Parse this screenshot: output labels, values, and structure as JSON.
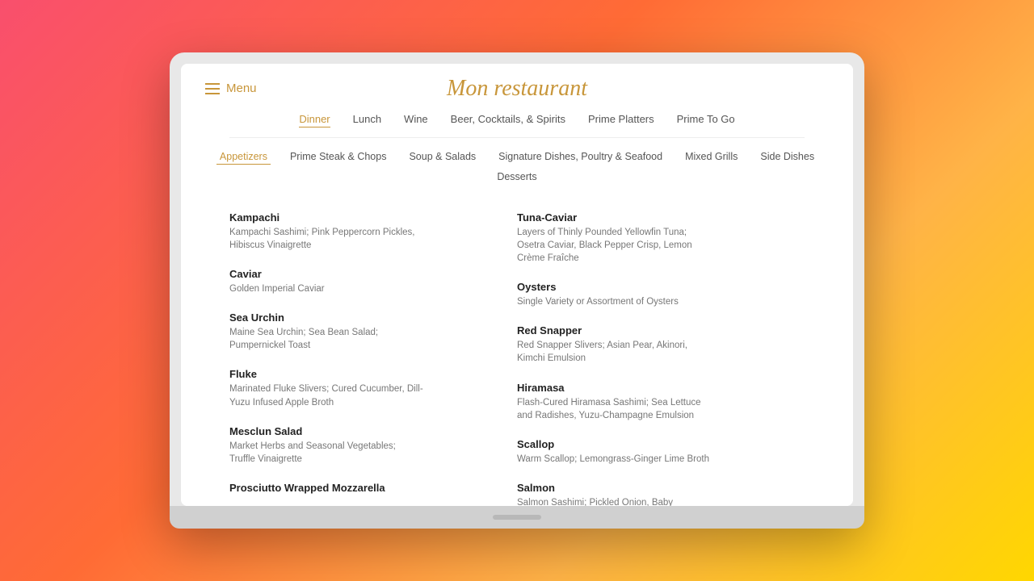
{
  "restaurant": {
    "title": "Mon restaurant"
  },
  "hamburger": {
    "label": "Menu"
  },
  "main_nav": {
    "items": [
      {
        "id": "dinner",
        "label": "Dinner",
        "active": true
      },
      {
        "id": "lunch",
        "label": "Lunch",
        "active": false
      },
      {
        "id": "wine",
        "label": "Wine",
        "active": false
      },
      {
        "id": "beer",
        "label": "Beer, Cocktails, & Spirits",
        "active": false
      },
      {
        "id": "platters",
        "label": "Prime Platters",
        "active": false
      },
      {
        "id": "togo",
        "label": "Prime To Go",
        "active": false
      }
    ]
  },
  "sub_nav": {
    "items": [
      {
        "id": "appetizers",
        "label": "Appetizers",
        "active": true
      },
      {
        "id": "prime-steak",
        "label": "Prime Steak & Chops",
        "active": false
      },
      {
        "id": "soup",
        "label": "Soup & Salads",
        "active": false
      },
      {
        "id": "signature",
        "label": "Signature Dishes, Poultry & Seafood",
        "active": false
      },
      {
        "id": "mixed-grills",
        "label": "Mixed Grills",
        "active": false
      },
      {
        "id": "side-dishes",
        "label": "Side Dishes",
        "active": false
      },
      {
        "id": "desserts",
        "label": "Desserts",
        "active": false
      }
    ]
  },
  "menu_items": {
    "left_column": [
      {
        "name": "Kampachi",
        "description": "Kampachi Sashimi; Pink Peppercorn Pickles, Hibiscus Vinaigrette"
      },
      {
        "name": "Caviar",
        "description": "Golden Imperial Caviar"
      },
      {
        "name": "Sea Urchin",
        "description": "Maine Sea Urchin; Sea Bean Salad; Pumpernickel Toast"
      },
      {
        "name": "Fluke",
        "description": "Marinated Fluke Slivers; Cured Cucumber, Dill-Yuzu Infused Apple Broth"
      },
      {
        "name": "Mesclun Salad",
        "description": "Market Herbs and Seasonal Vegetables; Truffle Vinaigrette"
      },
      {
        "name": "Prosciutto Wrapped Mozzarella",
        "description": ""
      }
    ],
    "right_column": [
      {
        "name": "Tuna-Caviar",
        "description": "Layers of Thinly Pounded Yellowfin Tuna; Osetra Caviar, Black Pepper Crisp, Lemon Crème Fraîche"
      },
      {
        "name": "Oysters",
        "description": "Single Variety or Assortment of Oysters"
      },
      {
        "name": "Red Snapper",
        "description": "Red Snapper Slivers; Asian Pear, Akinori, Kimchi Emulsion"
      },
      {
        "name": "Hiramasa",
        "description": "Flash-Cured Hiramasa Sashimi; Sea Lettuce and Radishes, Yuzu-Champagne Emulsion"
      },
      {
        "name": "Scallop",
        "description": "Warm Scallop; Lemongrass-Ginger Lime Broth"
      },
      {
        "name": "Salmon",
        "description": "Salmon Sashimi; Pickled Onion, Baby Cucumber Flowers, Amahari-Argan Oil"
      }
    ]
  }
}
